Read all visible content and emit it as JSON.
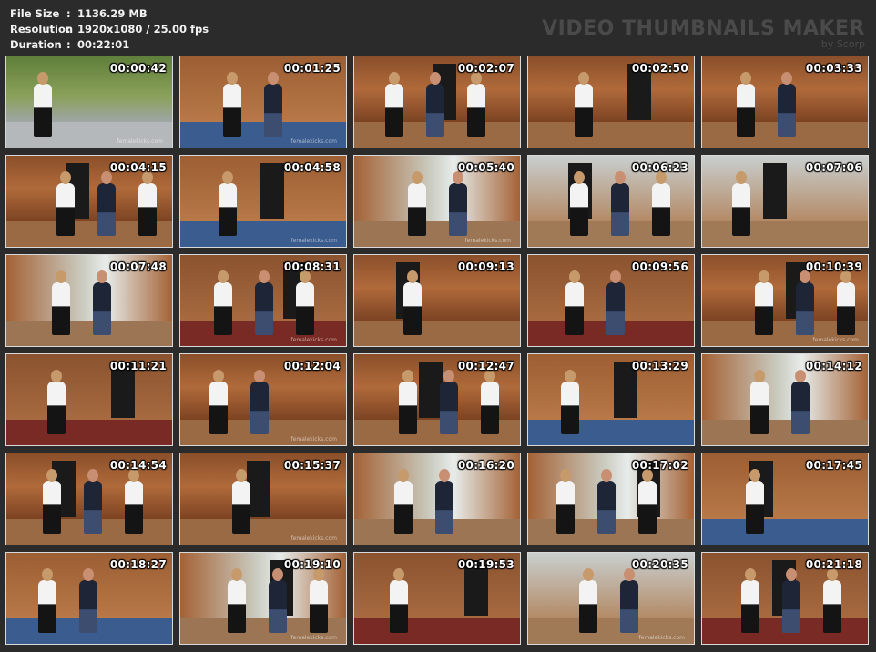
{
  "info": {
    "file_size_label": "File Size",
    "file_size_value": "1136.29 MB",
    "resolution_label": "Resolution",
    "resolution_value": "1920x1080 / 25.00 fps",
    "duration_label": "Duration",
    "duration_value": "00:22:01",
    "separator": ":"
  },
  "brand": {
    "title": "VIDEO THUMBNAILS MAKER",
    "subtitle": "by Scorp"
  },
  "watermark": "femalekicks.com",
  "thumbnails": [
    {
      "time": "00:00:42",
      "scene": "outdoor"
    },
    {
      "time": "00:01:25",
      "scene": "rug"
    },
    {
      "time": "00:02:07",
      "scene": "wood"
    },
    {
      "time": "00:02:50",
      "scene": "wood"
    },
    {
      "time": "00:03:33",
      "scene": "wood"
    },
    {
      "time": "00:04:15",
      "scene": "wood"
    },
    {
      "time": "00:04:58",
      "scene": "rug"
    },
    {
      "time": "00:05:40",
      "scene": "window"
    },
    {
      "time": "00:06:23",
      "scene": "bright"
    },
    {
      "time": "00:07:06",
      "scene": "bright"
    },
    {
      "time": "00:07:48",
      "scene": "window"
    },
    {
      "time": "00:08:31",
      "scene": "redrug"
    },
    {
      "time": "00:09:13",
      "scene": "wood"
    },
    {
      "time": "00:09:56",
      "scene": "redrug"
    },
    {
      "time": "00:10:39",
      "scene": "wood"
    },
    {
      "time": "00:11:21",
      "scene": "redrug"
    },
    {
      "time": "00:12:04",
      "scene": "wood"
    },
    {
      "time": "00:12:47",
      "scene": "wood"
    },
    {
      "time": "00:13:29",
      "scene": "rug"
    },
    {
      "time": "00:14:12",
      "scene": "window"
    },
    {
      "time": "00:14:54",
      "scene": "wood"
    },
    {
      "time": "00:15:37",
      "scene": "wood"
    },
    {
      "time": "00:16:20",
      "scene": "window"
    },
    {
      "time": "00:17:02",
      "scene": "window"
    },
    {
      "time": "00:17:45",
      "scene": "rug"
    },
    {
      "time": "00:18:27",
      "scene": "rug"
    },
    {
      "time": "00:19:10",
      "scene": "window"
    },
    {
      "time": "00:19:53",
      "scene": "redrug"
    },
    {
      "time": "00:20:35",
      "scene": "bright"
    },
    {
      "time": "00:21:18",
      "scene": "redrug"
    }
  ]
}
